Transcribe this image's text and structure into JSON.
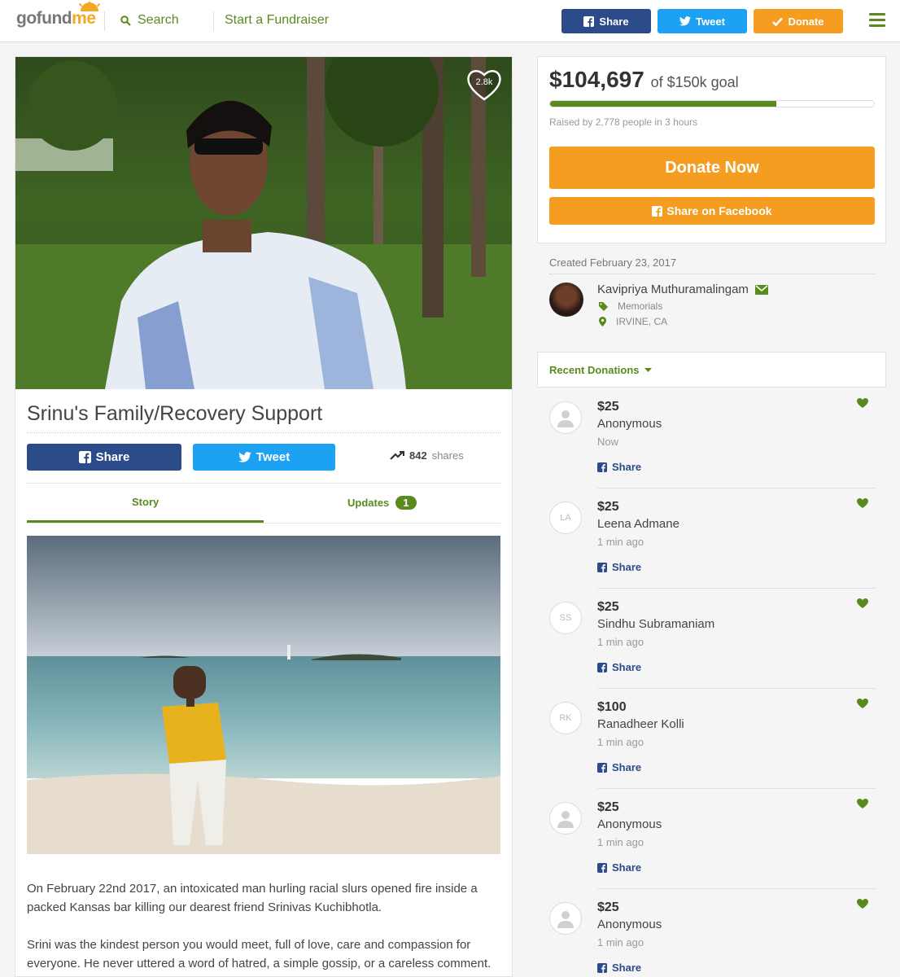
{
  "header": {
    "logo_go": "gofund",
    "logo_me": "me",
    "search_label": "Search",
    "start_label": "Start a Fundraiser",
    "share_label": "Share",
    "tweet_label": "Tweet",
    "donate_label": "Donate"
  },
  "campaign": {
    "heart_count": "2.8k",
    "title": "Srinu's Family/Recovery Support",
    "share_label": "Share",
    "tweet_label": "Tweet",
    "share_count": "842",
    "shares_word": "shares",
    "tabs": {
      "story": "Story",
      "updates": "Updates",
      "updates_count": "1"
    },
    "story_paragraphs": [
      "On February 22nd 2017,  an intoxicated man hurling racial slurs opened fire inside a packed Kansas bar killing our dearest friend Srinivas Kuchibhotla.",
      "Srini was the kindest person you would meet, full of love, care and compassion for everyone. He never uttered a word of hatred, a simple gossip, or a careless comment. He"
    ]
  },
  "goal": {
    "raised": "$104,697",
    "of_goal": "of $150k goal",
    "progress_fraction": 0.698,
    "raised_by": "Raised by 2,778 people in 3 hours",
    "donate_now": "Donate Now",
    "share_facebook": "Share on Facebook"
  },
  "organizer": {
    "created": "Created February 23, 2017",
    "name": "Kavipriya Muthuramalingam",
    "category": "Memorials",
    "location": "IRVINE, CA"
  },
  "recent": {
    "label": "Recent Donations",
    "share_label": "Share",
    "items": [
      {
        "amount": "$25",
        "name": "Anonymous",
        "time": "Now",
        "initials": ""
      },
      {
        "amount": "$25",
        "name": "Leena Admane",
        "time": "1 min ago",
        "initials": "LA"
      },
      {
        "amount": "$25",
        "name": "Sindhu Subramaniam",
        "time": "1 min ago",
        "initials": "SS"
      },
      {
        "amount": "$100",
        "name": "Ranadheer Kolli",
        "time": "1 min ago",
        "initials": "RK"
      },
      {
        "amount": "$25",
        "name": "Anonymous",
        "time": "1 min ago",
        "initials": ""
      },
      {
        "amount": "$25",
        "name": "Anonymous",
        "time": "1 min ago",
        "initials": ""
      }
    ]
  },
  "colors": {
    "brand_green": "#5a8a1e",
    "brand_orange": "#f49d20",
    "facebook_blue": "#2c4b8a",
    "twitter_blue": "#1da1f2"
  }
}
